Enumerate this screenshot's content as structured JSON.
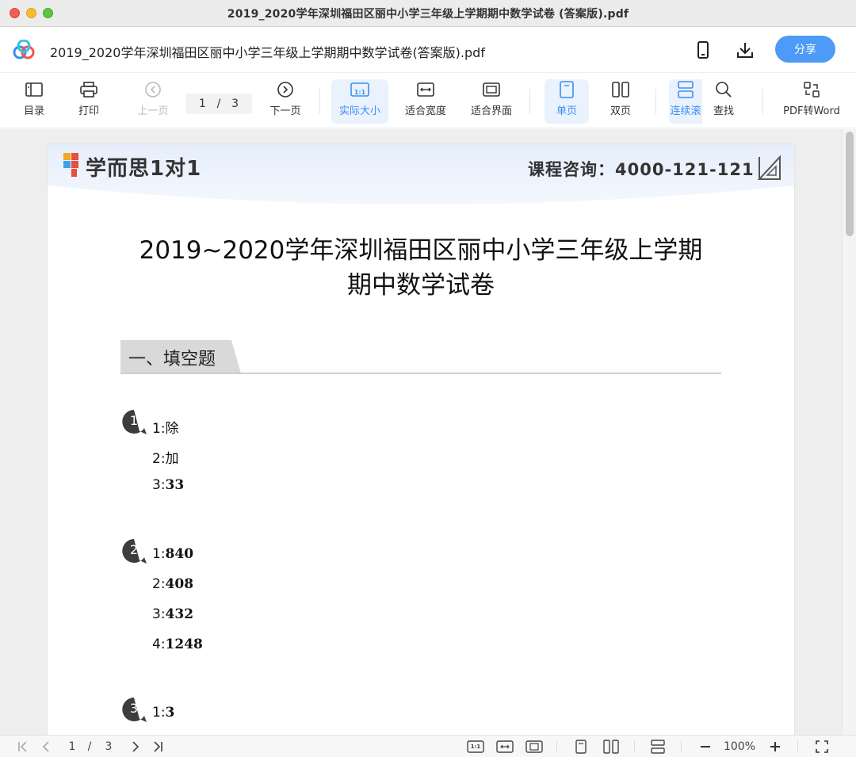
{
  "window": {
    "title": "2019_2020学年深圳福田区丽中小学三年级上学期期中数学试卷 (答案版).pdf"
  },
  "header": {
    "file_name": "2019_2020学年深圳福田区丽中小学三年级上学期期中数学试卷(答案版).pdf",
    "share_label": "分享",
    "icons": [
      "mobile-icon",
      "download-icon"
    ]
  },
  "toolbar": {
    "toc": "目录",
    "print": "打印",
    "prev_page": "上一页",
    "current_page": "1",
    "page_sep": "/",
    "total_pages": "3",
    "next_page": "下一页",
    "actual_size": "实际大小",
    "fit_width": "适合宽度",
    "fit_page": "适合界面",
    "single_page": "单页",
    "double_page": "双页",
    "continuous": "连续滚",
    "search": "查找",
    "pdf_to_word": "PDF转Word",
    "actual_size_icon_text": "1:1"
  },
  "document": {
    "brand": "学而思1对1",
    "consult": "课程咨询：4000-121-121",
    "title_line1": "2019~2020学年深圳福田区丽中小学三年级上学期",
    "title_line2": "期中数学试卷",
    "section": "一、填空题",
    "questions": [
      {
        "num": "1",
        "answers": [
          {
            "label": "1:",
            "value": "除"
          },
          {
            "label": "2:",
            "value": "加"
          },
          {
            "label": "3:",
            "value": "33"
          }
        ]
      },
      {
        "num": "2",
        "answers": [
          {
            "label": "1:",
            "value": "840"
          },
          {
            "label": "2:",
            "value": "408"
          },
          {
            "label": "3:",
            "value": "432"
          },
          {
            "label": "4:",
            "value": "1248"
          }
        ]
      },
      {
        "num": "3",
        "answers": [
          {
            "label": "1:",
            "value": "3"
          }
        ]
      }
    ]
  },
  "statusbar": {
    "current_page": "1",
    "page_sep": "/",
    "total_pages": "3",
    "zoom": "100%",
    "actual_size_icon_text": "1:1"
  },
  "colors": {
    "accent": "#4d9bf6",
    "active_bg": "#eaf2fd",
    "active_text": "#3d8ef2"
  }
}
